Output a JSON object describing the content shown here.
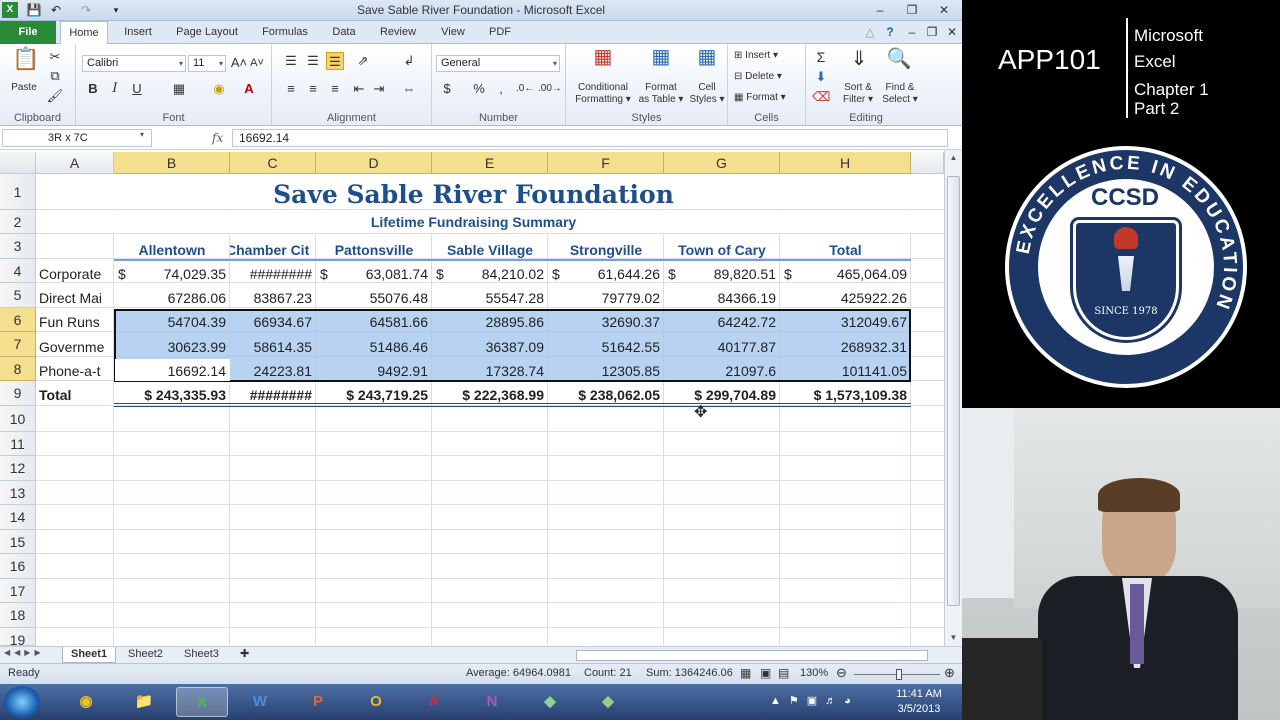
{
  "window": {
    "title": "Save Sable River Foundation  -  Microsoft Excel"
  },
  "ribbon": {
    "tabs": [
      "File",
      "Home",
      "Insert",
      "Page Layout",
      "Formulas",
      "Data",
      "Review",
      "View",
      "PDF"
    ],
    "font_name": "Calibri",
    "font_size": "11",
    "number_format": "General",
    "paste": "Paste",
    "groups": {
      "clipboard": "Clipboard",
      "font": "Font",
      "alignment": "Alignment",
      "number": "Number",
      "styles": "Styles",
      "cells": "Cells",
      "editing": "Editing"
    },
    "styles": {
      "cond1": "Conditional",
      "cond2": "Formatting ▾",
      "fmt1": "Format",
      "fmt2": "as Table ▾",
      "cell1": "Cell",
      "cell2": "Styles ▾"
    },
    "cells": {
      "insert": "Insert ▾",
      "delete": "Delete ▾",
      "format": "Format ▾"
    },
    "editing": {
      "sort1": "Sort &",
      "sort2": "Filter ▾",
      "find1": "Find &",
      "find2": "Select ▾"
    },
    "bold": "B",
    "italic": "I",
    "underline": "U",
    "currency": "$",
    "percent": "%",
    "comma": ","
  },
  "formula_bar": {
    "name_box": "3R x 7C",
    "fx": "fx",
    "value": "16692.14"
  },
  "grid": {
    "columns": [
      "A",
      "B",
      "C",
      "D",
      "E",
      "F",
      "G",
      "H"
    ],
    "rows": [
      "1",
      "2",
      "3",
      "4",
      "5",
      "6",
      "7",
      "8",
      "9",
      "10",
      "11",
      "12",
      "13",
      "14",
      "15",
      "16",
      "17",
      "18",
      "19"
    ],
    "title": "Save Sable River Foundation",
    "subtitle": "Lifetime Fundraising Summary",
    "headers": [
      "Allentown",
      "Chamber Cit",
      "Pattonsville",
      "Sable Village",
      "Strongville",
      "Town of Cary",
      "Total"
    ],
    "row_labels": [
      "Corporate",
      "Direct Mai",
      "Fun Runs",
      "Governme",
      "Phone-a-t",
      "Total"
    ],
    "r4": [
      "74,029.35",
      "########",
      "63,081.74",
      "84,210.02",
      "61,644.26",
      "89,820.51",
      "465,064.09"
    ],
    "r5": [
      "67286.06",
      "83867.23",
      "55076.48",
      "55547.28",
      "79779.02",
      "84366.19",
      "425922.26"
    ],
    "r6": [
      "54704.39",
      "66934.67",
      "64581.66",
      "28895.86",
      "32690.37",
      "64242.72",
      "312049.67"
    ],
    "r7": [
      "30623.99",
      "58614.35",
      "51486.46",
      "36387.09",
      "51642.55",
      "40177.87",
      "268932.31"
    ],
    "r8": [
      "16692.14",
      "24223.81",
      "9492.91",
      "17328.74",
      "12305.85",
      "21097.6",
      "101141.05"
    ],
    "r9": [
      "$ 243,335.93",
      "########",
      "$ 243,719.25",
      "$ 222,368.99",
      "$ 238,062.05",
      "$ 299,704.89",
      "$ 1,573,109.38"
    ],
    "currency_symbol": "$"
  },
  "sheets": [
    "Sheet1",
    "Sheet2",
    "Sheet3"
  ],
  "status": {
    "ready": "Ready",
    "average": "Average: 64964.0981",
    "count": "Count: 21",
    "sum": "Sum: 1364246.06",
    "zoom": "130%"
  },
  "taskbar": {
    "time": "11:41 AM",
    "date": "3/5/2013"
  },
  "slide": {
    "course": "APP101",
    "line1": "Microsoft",
    "line2": "Excel",
    "line3": "Chapter 1",
    "line4": "Part 2",
    "seal_title": "CCSD",
    "seal_ring": "EXCELLENCE IN EDUCATION",
    "seal_since": "SINCE 1978"
  },
  "colors": {
    "accent_blue": "#1f4e8c",
    "selection": "#a0c4ec",
    "header_highlight": "#f4df8e",
    "file_tab": "#2a8a3a"
  }
}
